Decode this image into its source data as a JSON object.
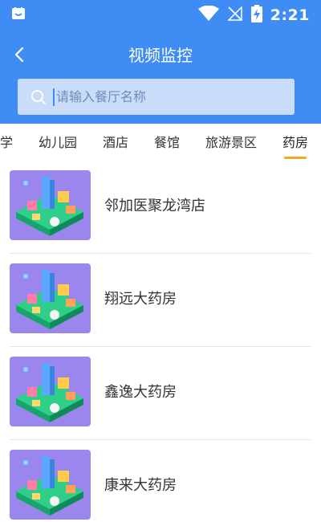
{
  "status_bar": {
    "time": "2:21",
    "icons": [
      "app-notification-icon",
      "wifi-icon",
      "no-signal-icon",
      "battery-charging-icon"
    ]
  },
  "header": {
    "title": "视频监控",
    "back_icon": "chevron-left-icon"
  },
  "search": {
    "placeholder": "请输入餐厅名称",
    "value": "",
    "icon": "search-icon"
  },
  "tabs": [
    {
      "label": "学",
      "active": false
    },
    {
      "label": "幼儿园",
      "active": false
    },
    {
      "label": "酒店",
      "active": false
    },
    {
      "label": "餐馆",
      "active": false
    },
    {
      "label": "旅游景区",
      "active": false
    },
    {
      "label": "药房",
      "active": true
    }
  ],
  "colors": {
    "primary": "#3f8cf5",
    "search_bg": "#c9ddfb",
    "active_underline": "#f5a623",
    "thumb_bg": "#9a86ec"
  },
  "stores": [
    {
      "name": "邻加医聚龙湾店"
    },
    {
      "name": "翔远大药房"
    },
    {
      "name": "鑫逸大药房"
    },
    {
      "name": "康来大药房"
    }
  ]
}
